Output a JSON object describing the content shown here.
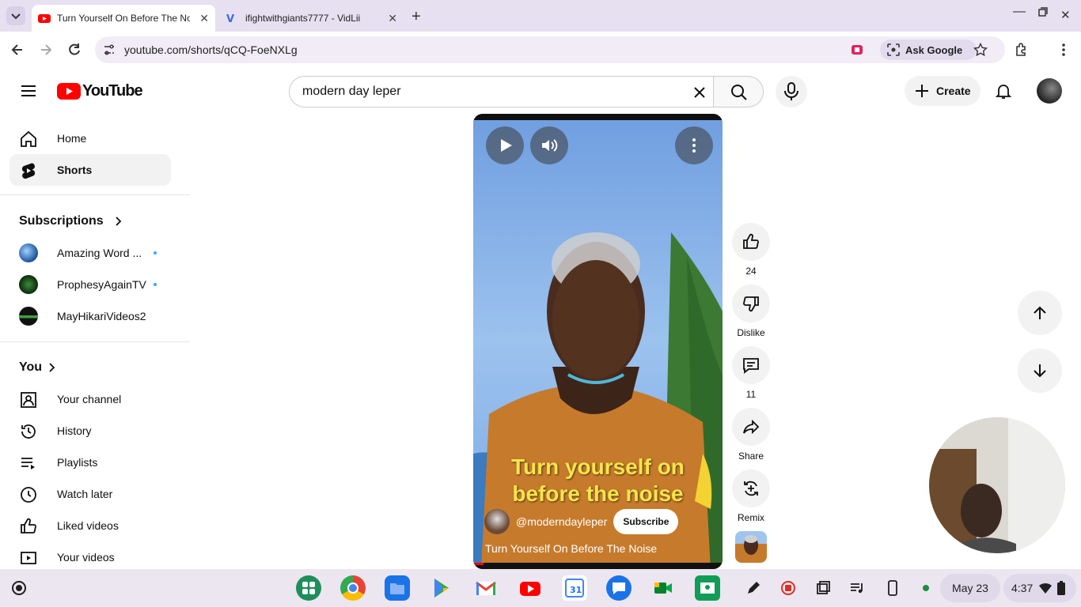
{
  "browser": {
    "tabs": [
      {
        "title": "Turn Yourself On Before The Noise",
        "active": true,
        "icon": "youtube-favicon"
      },
      {
        "title": "ifightwithgiants7777 - VidLii",
        "active": false,
        "icon": "vidlii-favicon"
      }
    ],
    "url": "youtube.com/shorts/qCQ-FoeNXLg",
    "ask_google": "Ask Google"
  },
  "header": {
    "logo_text": "YouTube",
    "search_value": "modern day leper",
    "create_label": "Create"
  },
  "sidebar": {
    "main": [
      {
        "label": "Home",
        "icon": "home-icon"
      },
      {
        "label": "Shorts",
        "icon": "shorts-icon",
        "selected": true
      }
    ],
    "subscriptions_title": "Subscriptions",
    "subscriptions": [
      {
        "label": "Amazing Word ...",
        "new": true
      },
      {
        "label": "ProphesyAgainTV",
        "new": true
      },
      {
        "label": "MayHikariVideos2",
        "new": false
      }
    ],
    "you_title": "You",
    "you_items": [
      {
        "label": "Your channel",
        "icon": "your-channel-icon"
      },
      {
        "label": "History",
        "icon": "history-icon"
      },
      {
        "label": "Playlists",
        "icon": "playlists-icon"
      },
      {
        "label": "Watch later",
        "icon": "watch-later-icon"
      },
      {
        "label": "Liked videos",
        "icon": "liked-videos-icon"
      },
      {
        "label": "Your videos",
        "icon": "your-videos-icon"
      }
    ]
  },
  "video": {
    "caption_line1": "Turn yourself on",
    "caption_line2": "before the noise",
    "channel_handle": "@moderndayleper",
    "subscribe_label": "Subscribe",
    "title": "Turn Yourself On Before The Noise",
    "progress": 0.04
  },
  "actions": {
    "like_count": "24",
    "dislike_label": "Dislike",
    "comment_count": "11",
    "share_label": "Share",
    "remix_label": "Remix"
  },
  "shelf": {
    "date": "May 23",
    "time": "4:37",
    "apps": [
      "launcher-icon",
      "chrome-icon",
      "files-icon",
      "play-store-icon",
      "gmail-icon",
      "youtube-icon",
      "calendar-icon",
      "messages-icon",
      "meet-icon",
      "classroom-icon"
    ]
  },
  "colors": {
    "youtube_red": "#ff0000",
    "tabstrip": "#e7e0f0",
    "caption_yellow": "#f6e64b"
  }
}
